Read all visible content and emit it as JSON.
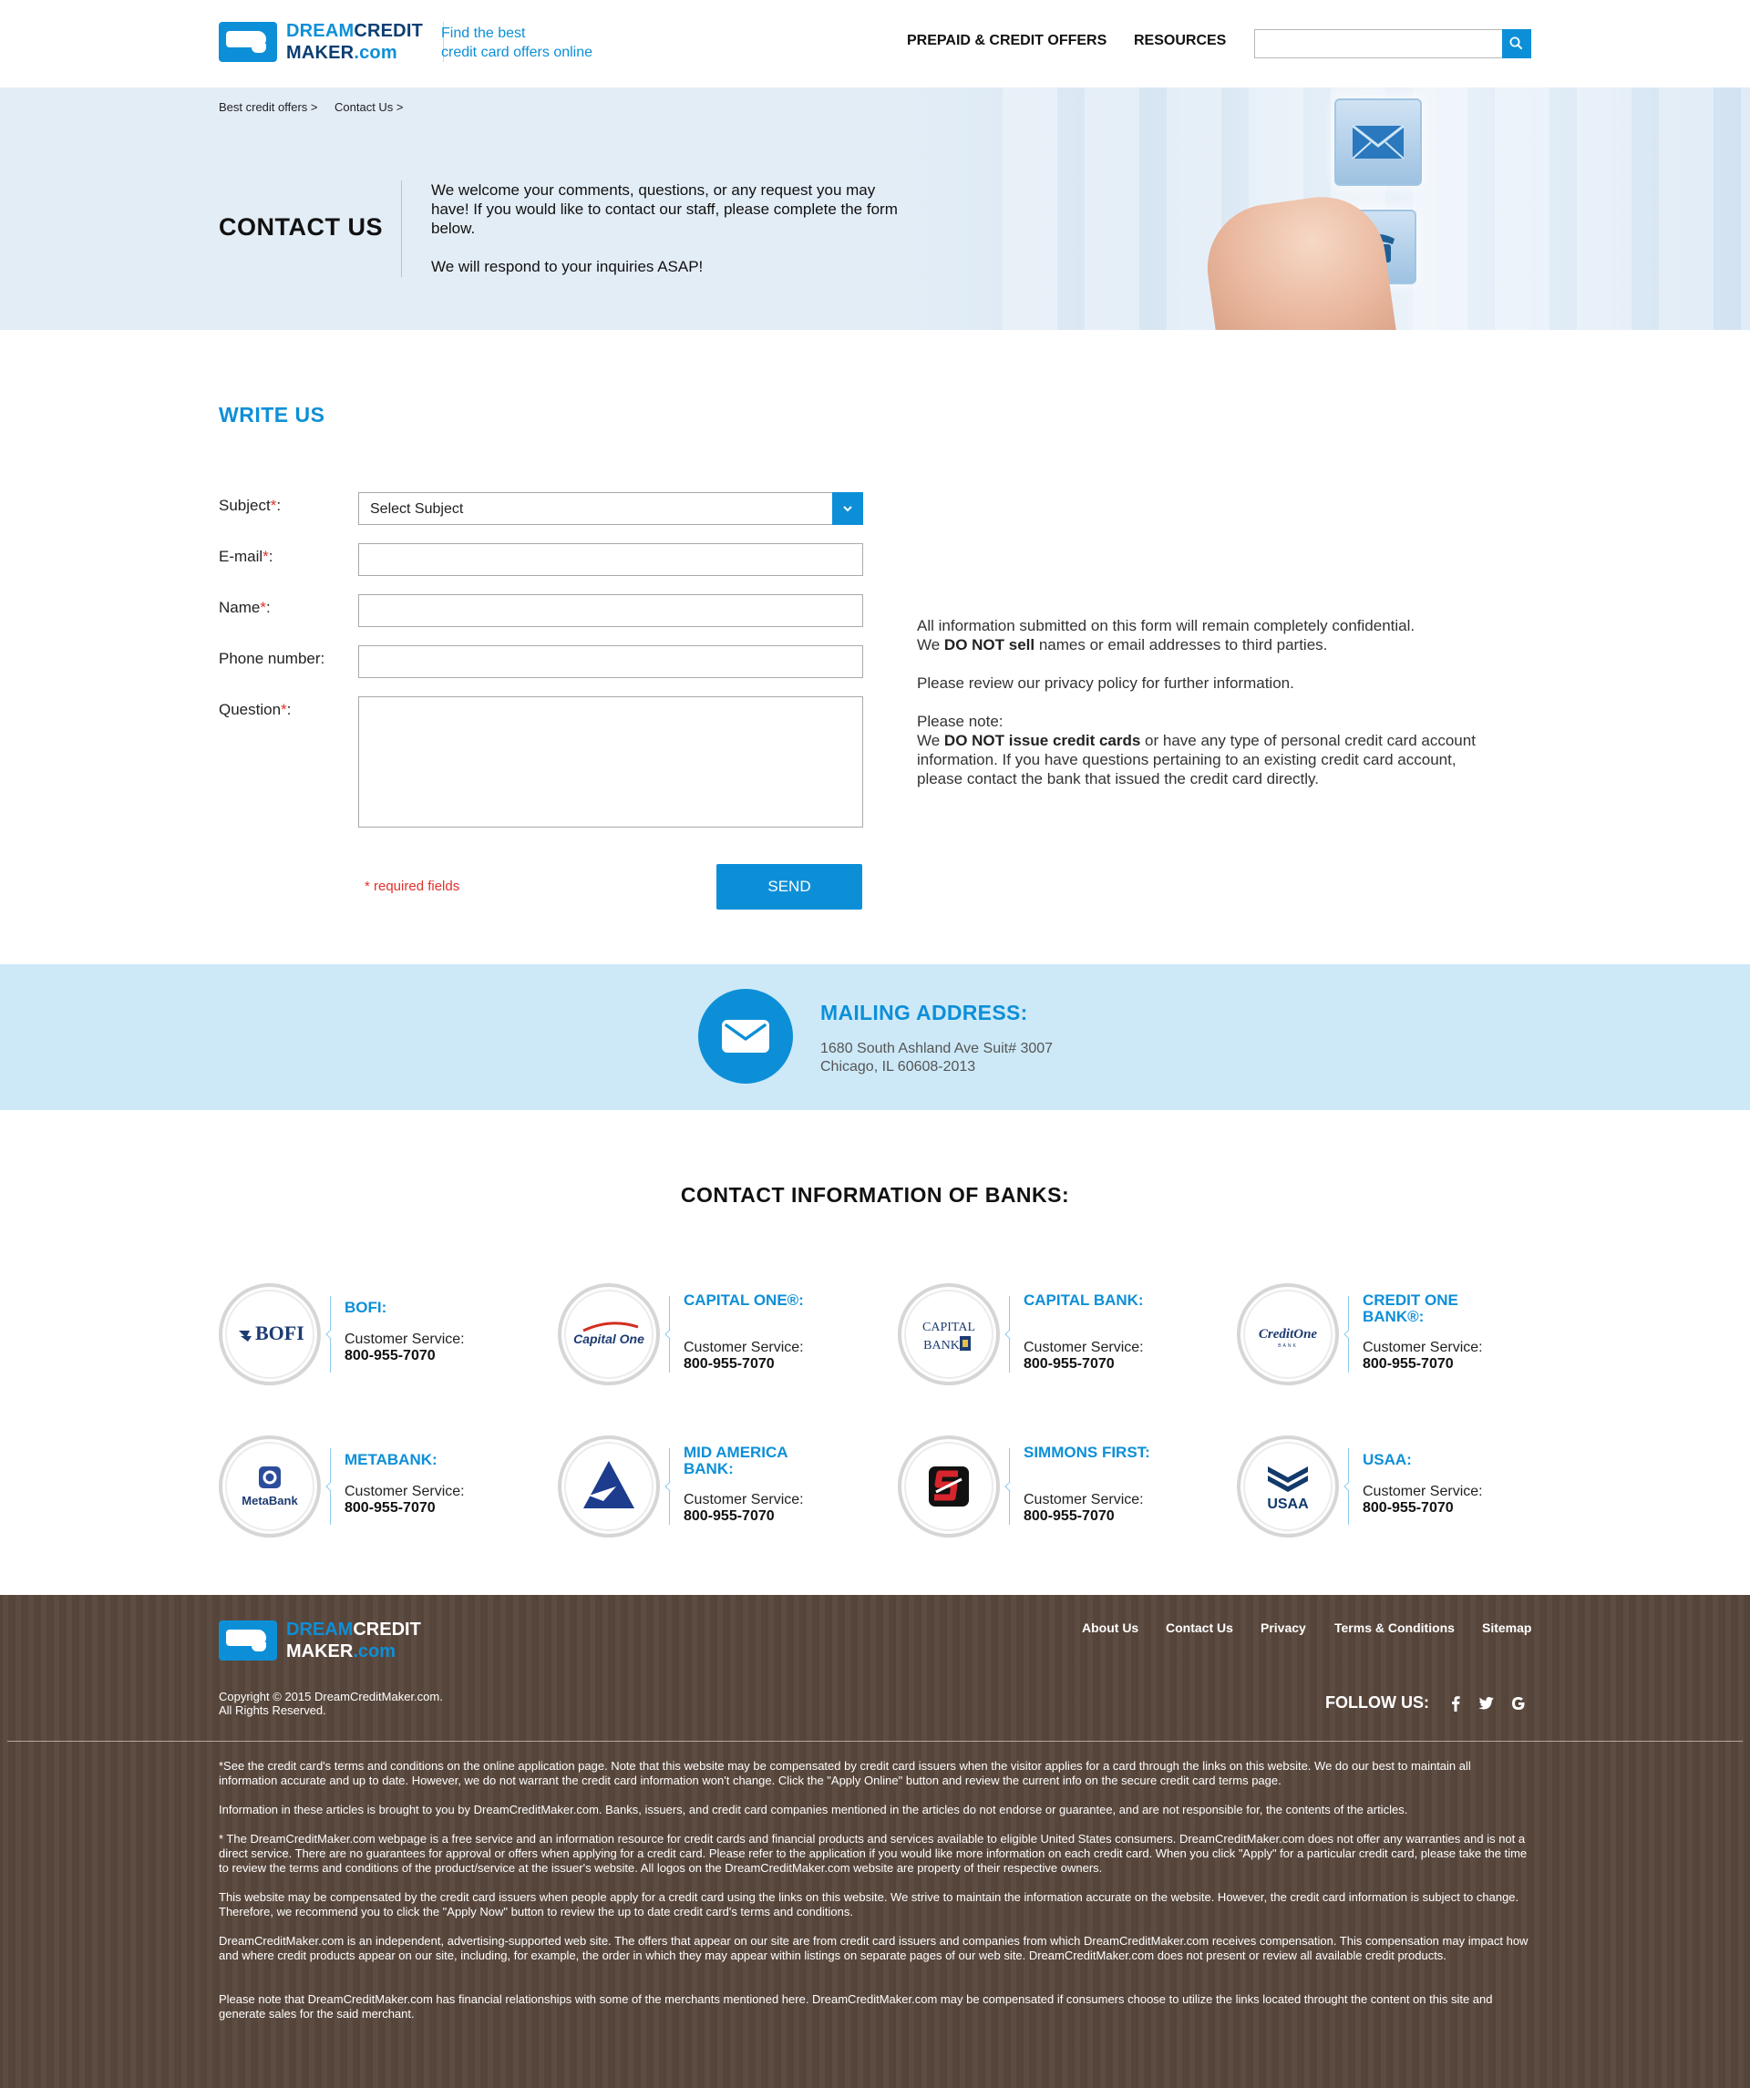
{
  "header": {
    "logo_dream": "DREAM",
    "logo_credit": "CREDIT",
    "logo_maker": "MAKER",
    "logo_com": ".com",
    "tagline_1": "Find the best",
    "tagline_2": "credit card offers online",
    "nav": [
      "PREPAID & CREDIT OFFERS",
      "RESOURCES"
    ],
    "search_placeholder": ""
  },
  "hero": {
    "breadcrumb": [
      "Best credit offers >",
      "Contact Us >"
    ],
    "title": "CONTACT US",
    "text_1": "We welcome your comments, questions, or any request you may have! If you would like to contact our staff, please complete the form below.",
    "text_2": "We will respond to your inquiries ASAP!"
  },
  "form": {
    "heading": "WRITE US",
    "subject_label": "Subject",
    "subject_value": "Select Subject",
    "email_label": "E-mail",
    "name_label": "Name",
    "phone_label": "Phone number:",
    "question_label": "Question",
    "required_mark": "*",
    "colon": ":",
    "required_note": "* required fields",
    "send_label": "SEND"
  },
  "info": {
    "p1_a": "All information submitted on this form will remain completely confidential.",
    "p1_b": "We ",
    "p1_bold": "DO NOT sell",
    "p1_c": " names or email addresses to third parties.",
    "p2": "Please review our privacy policy for further information.",
    "p3_title": "Please note:",
    "p3_a": "We ",
    "p3_bold": "DO NOT issue credit cards",
    "p3_b": " or have any type of personal credit card account information. If you have questions pertaining to an existing credit card account, please contact the bank that issued the credit card directly."
  },
  "mailing": {
    "title": "MAILING ADDRESS:",
    "line1": "1680 South Ashland Ave Suit# 3007",
    "line2": "Chicago, IL 60608-2013"
  },
  "banks": {
    "title": "CONTACT INFORMATION OF BANKS:",
    "cs_label": "Customer Service:",
    "items": [
      {
        "name": "BOFI:",
        "phone": "800-955-7070",
        "logo": "BOFI"
      },
      {
        "name": "CAPITAL ONE®:",
        "phone": "800-955-7070",
        "logo": "Capital One"
      },
      {
        "name": "CAPITAL BANK:",
        "phone": "800-955-7070",
        "logo": "CAPITAL BANK"
      },
      {
        "name": "CREDIT ONE BANK®:",
        "phone": "800-955-7070",
        "logo": "CreditOne"
      },
      {
        "name": "METABANK:",
        "phone": "800-955-7070",
        "logo": "MetaBank"
      },
      {
        "name": "MID AMERICA BANK:",
        "phone": "800-955-7070",
        "logo": ""
      },
      {
        "name": "SIMMONS FIRST:",
        "phone": "800-955-7070",
        "logo": ""
      },
      {
        "name": "USAA:",
        "phone": "800-955-7070",
        "logo": "USAA"
      }
    ]
  },
  "footer": {
    "links": [
      "About Us",
      "Contact Us",
      "Privacy",
      "Terms & Conditions",
      "Sitemap"
    ],
    "copyright_1": "Copyright © 2015 DreamCreditMaker.com.",
    "copyright_2": "All Rights Reserved.",
    "follow_label": "FOLLOW US:",
    "disclaimers": [
      "*See the credit card's terms and conditions on the online application page. Note that this website may be compensated by credit card issuers when the visitor applies for a card through the links on this website. We do our best to maintain all information accurate and up to date. However, we do not warrant the credit card information won't change. Click the \"Apply Online\" button and review the current info on the secure credit card terms page.",
      "Information in these articles is brought to you by DreamCreditMaker.com. Banks, issuers, and credit card companies mentioned in the articles do not endorse or guarantee, and are not responsible for, the contents of the articles.",
      "* The DreamCreditMaker.com webpage is a free service and an information resource for credit cards and financial products and services available to eligible United States consumers. DreamCreditMaker.com does not offer any warranties and is not a direct service. There are no guarantees for approval or offers when applying for a credit card. Please refer to the application if you would like more information on each credit card. When you click \"Apply\" for a particular credit card, please take the time to review the terms and conditions of the product/service at the issuer's website. All logos on the DreamCreditMaker.com website are property of their respective owners.",
      "This website may be compensated by the credit card issuers when people apply for a credit card using the links on this website. We strive to maintain the information accurate on the website. However, the credit card information is subject to change. Therefore, we recommend you to click the \"Apply Now\" button to review the up to date credit card's terms and conditions.",
      "DreamCreditMaker.com is an independent, advertising-supported web site. The offers that appear on our site are from credit card issuers and companies from which DreamCreditMaker.com receives compensation. This compensation may impact how and where credit products appear on our site, including, for example, the order in which they may appear within listings on separate pages of our web site. DreamCreditMaker.com does not present or review all available credit products.",
      "Please note that DreamCreditMaker.com has financial relationships with some of the merchants mentioned here. DreamCreditMaker.com may be compensated if consumers choose to utilize the links located throught the content on this site and generate sales for the said merchant."
    ]
  },
  "colors": {
    "accent": "#0d8fd8",
    "navy": "#0b3e73",
    "hero_bg": "#e3edf6",
    "mail_bg": "#cde9f8",
    "footer_bg": "#5a483d",
    "required": "#e0312c"
  }
}
